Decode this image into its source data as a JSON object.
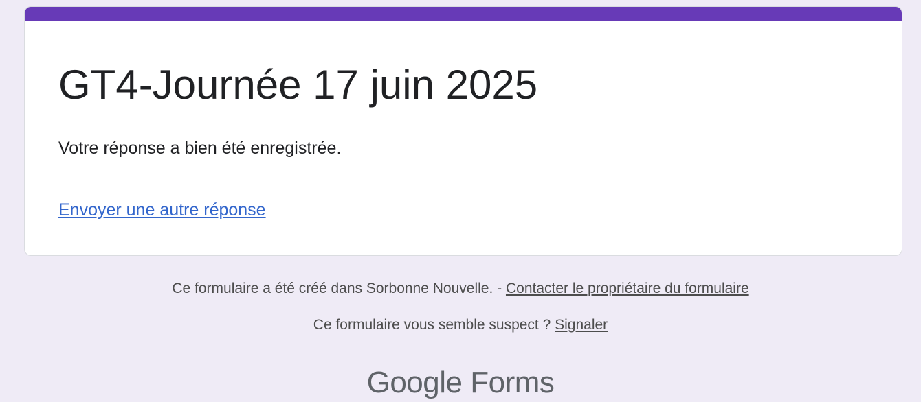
{
  "form": {
    "title": "GT4-Journée 17 juin 2025",
    "confirmation_message": "Votre réponse a bien été enregistrée.",
    "another_response_link": "Envoyer une autre réponse"
  },
  "footer": {
    "created_in_text": "Ce formulaire a été créé dans Sorbonne Nouvelle. - ",
    "contact_owner_link": "Contacter le propriétaire du formulaire",
    "suspect_text": "Ce formulaire vous semble suspect ? ",
    "report_link": "Signaler"
  },
  "branding": {
    "google": "Google",
    "forms": "Forms"
  },
  "colors": {
    "accent": "#673ab7",
    "background": "#efebf6",
    "link": "#3366cc"
  }
}
